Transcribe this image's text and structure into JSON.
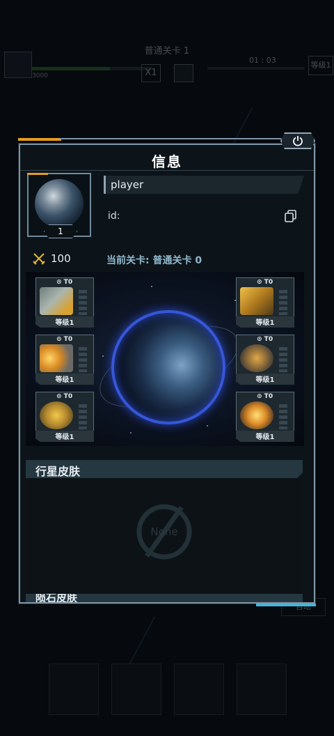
{
  "background": {
    "stage_title": "普通关卡 1",
    "score": "3000",
    "speed_label": "X1",
    "timer": "01 : 03",
    "level_button": "等级1",
    "auto_button": "自动"
  },
  "panel": {
    "title": "信息",
    "close_icon": "power-icon"
  },
  "player": {
    "name": "player",
    "id_label": "id:",
    "level": "1",
    "power_value": "100",
    "current_stage_label": "当前关卡:",
    "current_stage_value": "普通关卡 0"
  },
  "equipment": {
    "left": [
      {
        "tier": "⊙ T0",
        "level": "等级1",
        "icon": "cannon-turret-icon",
        "color": "#9aa7a0"
      },
      {
        "tier": "⊙ T0",
        "level": "等级1",
        "icon": "thruster-module-icon",
        "color": "#d9a030"
      },
      {
        "tier": "⊙ T0",
        "level": "等级1",
        "icon": "gold-core-icon",
        "color": "#c9a84a"
      }
    ],
    "right": [
      {
        "tier": "⊙ T0",
        "level": "等级1",
        "icon": "armor-crate-icon",
        "color": "#c79a2c"
      },
      {
        "tier": "⊙ T0",
        "level": "等级1",
        "icon": "ring-generator-icon",
        "color": "#b78a3a"
      },
      {
        "tier": "⊙ T0",
        "level": "等级1",
        "icon": "energy-reactor-icon",
        "color": "#e0902a"
      }
    ]
  },
  "skins": {
    "planet_skin_title": "行星皮肤",
    "none_label": "None",
    "second_skin_title": "陨石皮肤"
  },
  "colors": {
    "accent_orange": "#e39c22",
    "accent_blue": "#48b3d8",
    "shield_blue": "#3657d8",
    "stage_text": "#8fb7cb"
  }
}
